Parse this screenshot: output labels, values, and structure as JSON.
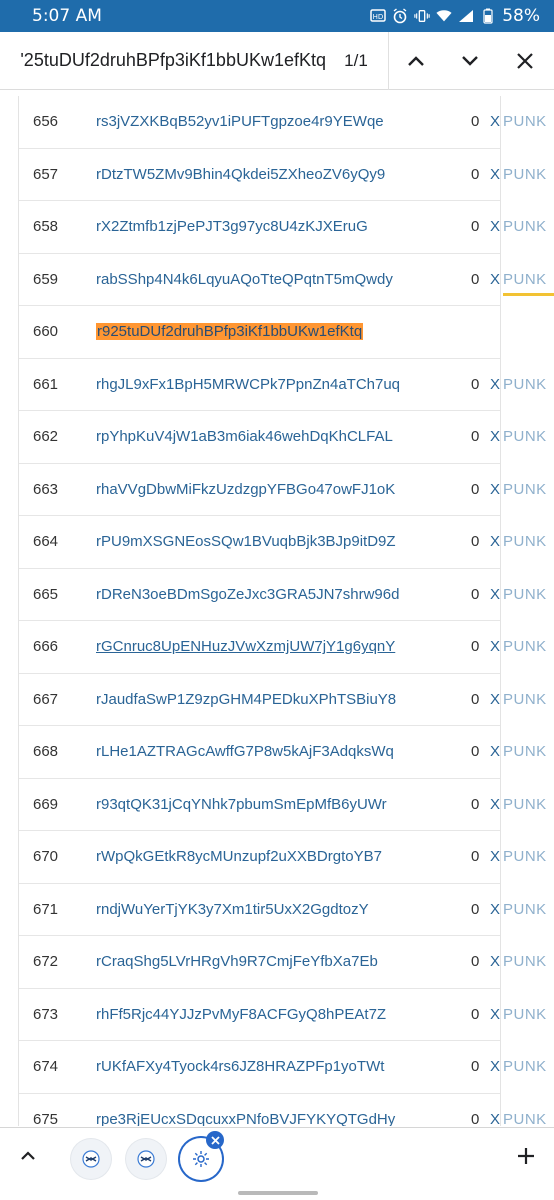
{
  "status_bar": {
    "time": "5:07 AM",
    "battery": "58%",
    "icons": [
      "cast-icon",
      "alarm-icon",
      "vibrate-icon",
      "wifi-icon",
      "signal-icon",
      "battery-icon"
    ]
  },
  "find_bar": {
    "query": "r925tuDUf2druhBPfp3iKf1bbUKw1efKtq",
    "visible_query": "'25tuDUf2druhBPfp3iKf1bbUKw1efKtq",
    "match_count": "1/1"
  },
  "table": {
    "rows": [
      {
        "num": "656",
        "addr": "rs3jVZXKBqB52yv1iPUFTgpzoe4r9YEWqe",
        "amount": "0",
        "currency": "X"
      },
      {
        "num": "657",
        "addr": "rDtzTW5ZMv9Bhin4Qkdei5ZXheoZV6yQy9",
        "amount": "0",
        "currency": "X"
      },
      {
        "num": "658",
        "addr": "rX2Ztmfb1zjPePJT3g97yc8U4zKJXEruG",
        "amount": "0",
        "currency": "X"
      },
      {
        "num": "659",
        "addr": "rabSShp4N4k6LqyuAQoTteQPqtnT5mQwdy",
        "amount": "0",
        "currency": "X"
      },
      {
        "num": "660",
        "addr": "r925tuDUf2druhBPfp3iKf1bbUKw1efKtq",
        "amount": "",
        "currency": ""
      },
      {
        "num": "661",
        "addr": "rhgJL9xFx1BpH5MRWCPk7PpnZn4aTCh7uq",
        "amount": "0",
        "currency": "X"
      },
      {
        "num": "662",
        "addr": "rpYhpKuV4jW1aB3m6iak46wehDqKhCLFAL",
        "amount": "0",
        "currency": "X"
      },
      {
        "num": "663",
        "addr": "rhaVVgDbwMiFkzUzdzgpYFBGo47owFJ1oK",
        "amount": "0",
        "currency": "X"
      },
      {
        "num": "664",
        "addr": "rPU9mXSGNEosSQw1BVuqbBjk3BJp9itD9Z",
        "amount": "0",
        "currency": "X"
      },
      {
        "num": "665",
        "addr": "rDReN3oeBDmSgoZeJxc3GRA5JN7shrw96d",
        "amount": "0",
        "currency": "X"
      },
      {
        "num": "666",
        "addr": "rGCnruc8UpENHuzJVwXzmjUW7jY1g6yqnY",
        "amount": "0",
        "currency": "X"
      },
      {
        "num": "667",
        "addr": "rJaudfaSwP1Z9zpGHM4PEDkuXPhTSBiuY8",
        "amount": "0",
        "currency": "X"
      },
      {
        "num": "668",
        "addr": "rLHe1AZTRAGcAwffG7P8w5kAjF3AdqksWq",
        "amount": "0",
        "currency": "X"
      },
      {
        "num": "669",
        "addr": "r93qtQK31jCqYNhk7pbumSmEpMfB6yUWr",
        "amount": "0",
        "currency": "X"
      },
      {
        "num": "670",
        "addr": "rWpQkGEtkR8ycMUnzupf2uXXBDrgtoYB7",
        "amount": "0",
        "currency": "X"
      },
      {
        "num": "671",
        "addr": "rndjWuYerTjYK3y7Xm1tir5UxX2GgdtozY",
        "amount": "0",
        "currency": "X"
      },
      {
        "num": "672",
        "addr": "rCraqShg5LVrHRgVh9R7CmjFeYfbXa7Eb",
        "amount": "0",
        "currency": "X"
      },
      {
        "num": "673",
        "addr": "rhFf5Rjc44YJJzPvMyF8ACFGyQ8hPEAt7Z",
        "amount": "0",
        "currency": "X"
      },
      {
        "num": "674",
        "addr": "rUKfAFXy4Tyock4rs6JZ8HRAZPFp1yoTWt",
        "amount": "0",
        "currency": "X"
      },
      {
        "num": "675",
        "addr": "rpe3RjEUcxSDqcuxxPNfoBVJFYKYQTGdHy",
        "amount": "0",
        "currency": "X"
      }
    ],
    "overflow_label": "PUNK",
    "highlighted_index": 4,
    "underlined_index": 10
  },
  "colors": {
    "status_bar_bg": "#1f6cab",
    "link": "#2a6496",
    "highlight": "#ff9632",
    "active_tab_ring": "#2767c9"
  },
  "tab_bar": {
    "icons": [
      "scroll-up-icon",
      "xrpscan-tab-icon",
      "xrpscan-tab-icon",
      "gear-tab-icon",
      "close-tab-icon",
      "add-tab-icon"
    ]
  }
}
